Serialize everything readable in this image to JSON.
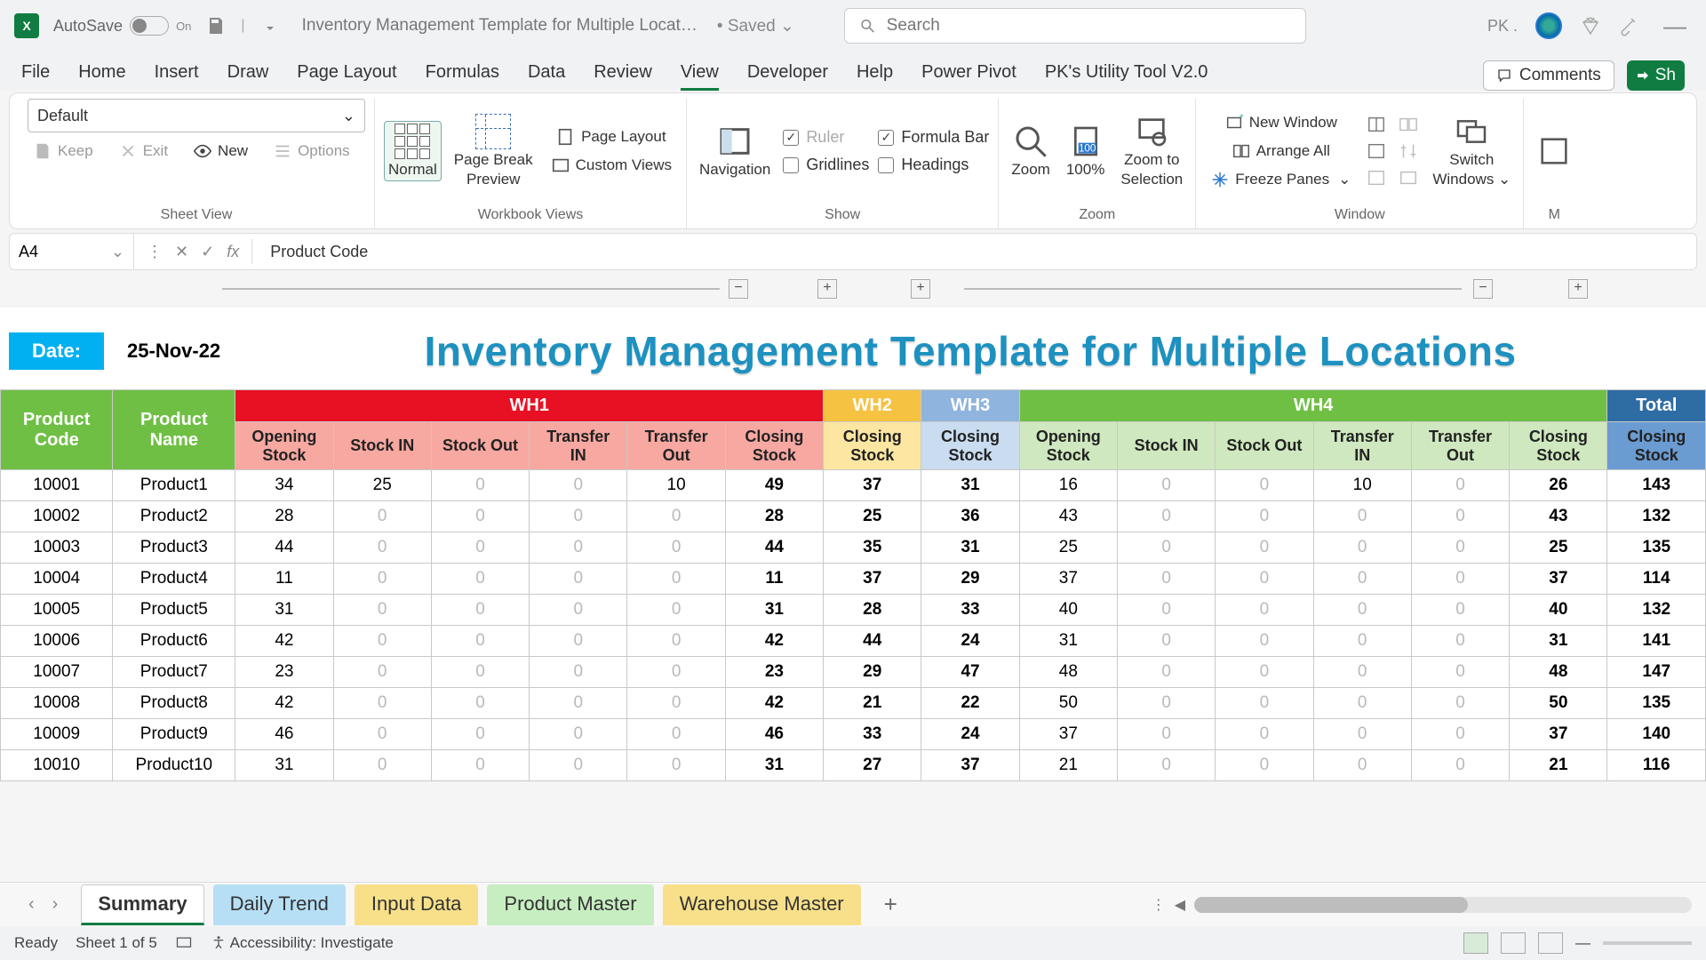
{
  "titlebar": {
    "autosave_label": "AutoSave",
    "autosave_state": "On",
    "filename": "Inventory Management Template for Multiple Locat…",
    "saved_state": "Saved",
    "search_placeholder": "Search",
    "user_initials": "PK ."
  },
  "ribbon_tabs": [
    "File",
    "Home",
    "Insert",
    "Draw",
    "Page Layout",
    "Formulas",
    "Data",
    "Review",
    "View",
    "Developer",
    "Help",
    "Power Pivot",
    "PK's Utility Tool V2.0"
  ],
  "ribbon_active": "View",
  "ribbon_right": {
    "comments": "Comments",
    "share": "Sh"
  },
  "ribbon": {
    "sheetview": {
      "dropdown": "Default",
      "keep": "Keep",
      "exit": "Exit",
      "new": "New",
      "options": "Options",
      "group": "Sheet View"
    },
    "workbook": {
      "normal": "Normal",
      "pbk1": "Page Break",
      "pbk2": "Preview",
      "pagelayout": "Page Layout",
      "custom": "Custom Views",
      "group": "Workbook Views"
    },
    "show": {
      "navigation": "Navigation",
      "ruler": "Ruler",
      "gridlines": "Gridlines",
      "formula": "Formula Bar",
      "headings": "Headings",
      "group": "Show"
    },
    "zoom": {
      "zoom": "Zoom",
      "hundred": "100%",
      "tosel1": "Zoom to",
      "tosel2": "Selection",
      "group": "Zoom"
    },
    "window": {
      "neww": "New Window",
      "arrange": "Arrange All",
      "freeze": "Freeze Panes",
      "switch1": "Switch",
      "switch2": "Windows",
      "group": "Window",
      "m": "M"
    }
  },
  "formula": {
    "namebox": "A4",
    "text": "Product Code"
  },
  "outline_buttons": [
    "−",
    "+",
    "+",
    "−",
    "+"
  ],
  "sheet": {
    "date_label": "Date:",
    "date_value": "25-Nov-22",
    "title": "Inventory Management Template for Multiple Locations",
    "row_headers": [
      "Product Code",
      "Product Name"
    ],
    "warehouses": [
      "WH1",
      "WH2",
      "WH3",
      "WH4",
      "Total"
    ],
    "sub_wh1": [
      "Opening Stock",
      "Stock IN",
      "Stock Out",
      "Transfer IN",
      "Transfer Out",
      "Closing Stock"
    ],
    "sub_single": "Closing Stock",
    "sub_wh4": [
      "Opening Stock",
      "Stock IN",
      "Stock Out",
      "Transfer IN",
      "Transfer Out",
      "Closing Stock"
    ],
    "rows": [
      {
        "code": "10001",
        "name": "Product1",
        "wh1": [
          34,
          25,
          0,
          0,
          10,
          49
        ],
        "wh2": 37,
        "wh3": 31,
        "wh4": [
          16,
          0,
          0,
          10,
          0,
          26
        ],
        "tot": 143
      },
      {
        "code": "10002",
        "name": "Product2",
        "wh1": [
          28,
          0,
          0,
          0,
          0,
          28
        ],
        "wh2": 25,
        "wh3": 36,
        "wh4": [
          43,
          0,
          0,
          0,
          0,
          43
        ],
        "tot": 132
      },
      {
        "code": "10003",
        "name": "Product3",
        "wh1": [
          44,
          0,
          0,
          0,
          0,
          44
        ],
        "wh2": 35,
        "wh3": 31,
        "wh4": [
          25,
          0,
          0,
          0,
          0,
          25
        ],
        "tot": 135
      },
      {
        "code": "10004",
        "name": "Product4",
        "wh1": [
          11,
          0,
          0,
          0,
          0,
          11
        ],
        "wh2": 37,
        "wh3": 29,
        "wh4": [
          37,
          0,
          0,
          0,
          0,
          37
        ],
        "tot": 114
      },
      {
        "code": "10005",
        "name": "Product5",
        "wh1": [
          31,
          0,
          0,
          0,
          0,
          31
        ],
        "wh2": 28,
        "wh3": 33,
        "wh4": [
          40,
          0,
          0,
          0,
          0,
          40
        ],
        "tot": 132
      },
      {
        "code": "10006",
        "name": "Product6",
        "wh1": [
          42,
          0,
          0,
          0,
          0,
          42
        ],
        "wh2": 44,
        "wh3": 24,
        "wh4": [
          31,
          0,
          0,
          0,
          0,
          31
        ],
        "tot": 141
      },
      {
        "code": "10007",
        "name": "Product7",
        "wh1": [
          23,
          0,
          0,
          0,
          0,
          23
        ],
        "wh2": 29,
        "wh3": 47,
        "wh4": [
          48,
          0,
          0,
          0,
          0,
          48
        ],
        "tot": 147
      },
      {
        "code": "10008",
        "name": "Product8",
        "wh1": [
          42,
          0,
          0,
          0,
          0,
          42
        ],
        "wh2": 21,
        "wh3": 22,
        "wh4": [
          50,
          0,
          0,
          0,
          0,
          50
        ],
        "tot": 135
      },
      {
        "code": "10009",
        "name": "Product9",
        "wh1": [
          46,
          0,
          0,
          0,
          0,
          46
        ],
        "wh2": 33,
        "wh3": 24,
        "wh4": [
          37,
          0,
          0,
          0,
          0,
          37
        ],
        "tot": 140
      },
      {
        "code": "10010",
        "name": "Product10",
        "wh1": [
          31,
          0,
          0,
          0,
          0,
          31
        ],
        "wh2": 27,
        "wh3": 37,
        "wh4": [
          21,
          0,
          0,
          0,
          0,
          21
        ],
        "tot": 116
      }
    ]
  },
  "sheet_tabs": [
    "Summary",
    "Daily Trend",
    "Input Data",
    "Product Master",
    "Warehouse Master"
  ],
  "statusbar": {
    "ready": "Ready",
    "sheet": "Sheet 1 of 5",
    "acc": "Accessibility: Investigate"
  }
}
